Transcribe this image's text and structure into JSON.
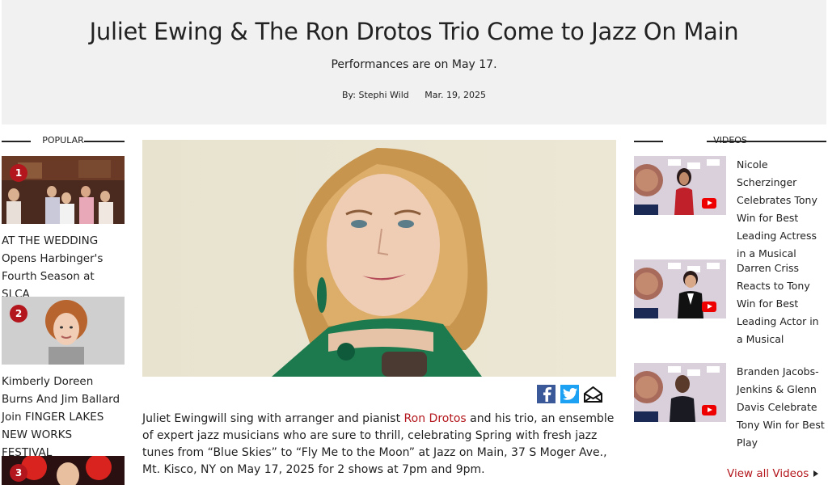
{
  "header": {
    "title": "Juliet Ewing & The Ron Drotos Trio Come to Jazz On Main",
    "subtitle": "Performances are on May 17.",
    "author": "By: Stephi Wild",
    "date": "Mar. 19, 2025"
  },
  "popular": {
    "title": "POPULAR",
    "items": [
      {
        "num": "1",
        "text": "AT THE WEDDING Opens Harbinger's Fourth Season at SLCA"
      },
      {
        "num": "2",
        "text": "Kimberly Doreen Burns And Jim Ballard Join FINGER LAKES NEW WORKS FESTIVAL"
      },
      {
        "num": "3",
        "text": ""
      }
    ]
  },
  "article": {
    "before_link": "Juliet Ewingwill sing with arranger and pianist ",
    "link": "Ron Drotos",
    "after_link": " and his trio, an ensemble of expert jazz musicians who are sure to thrill, celebrating Spring with fresh jazz tunes from “Blue Skies” to “Fly Me to the Moon” at Jazz on Main, 37 S Moger Ave., Mt. Kisco, NY on May 17, 2025 for 2 shows at 7pm and 9pm."
  },
  "share": {
    "icons": [
      "facebook-icon",
      "twitter-icon",
      "email-icon"
    ]
  },
  "videos": {
    "title": "VIDEOS",
    "items": [
      {
        "text": "Nicole Scherzinger Celebrates Tony Win for Best Leading Actress in a Musical"
      },
      {
        "text": "Darren Criss Reacts to Tony Win for Best Leading Actor in a Musical"
      },
      {
        "text": "Branden Jacobs-Jenkins & Glenn Davis Celebrate Tony Win for Best Play"
      }
    ],
    "view_all": "View all Videos"
  },
  "colors": {
    "accent": "#b3171d",
    "header_bg": "#f1f1f1",
    "facebook": "#3b5998",
    "twitter": "#1da1f2"
  }
}
